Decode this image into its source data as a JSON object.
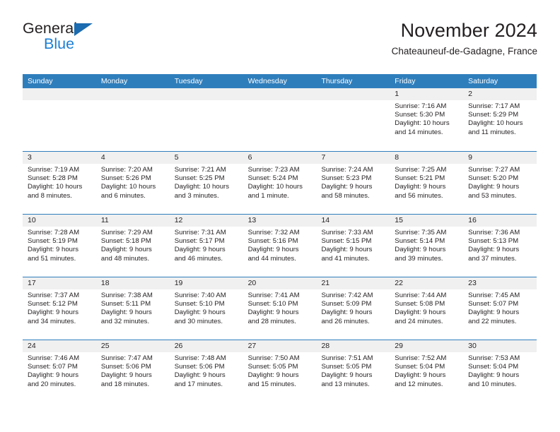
{
  "logo": {
    "word_one": "General",
    "word_two": "Blue",
    "triangle_icon": "blue-triangle-icon",
    "accent_dark": "#1b6cb0",
    "accent_light": "#1b7fd4"
  },
  "header": {
    "title": "November 2024",
    "subtitle": "Chateauneuf-de-Gadagne, France"
  },
  "theme": {
    "header_blue": "#2f7ebc",
    "day_band_gray": "#f0f0f0",
    "text": "#231f20"
  },
  "weekdays": [
    "Sunday",
    "Monday",
    "Tuesday",
    "Wednesday",
    "Thursday",
    "Friday",
    "Saturday"
  ],
  "weeks": [
    [
      {
        "day": "",
        "lines": []
      },
      {
        "day": "",
        "lines": []
      },
      {
        "day": "",
        "lines": []
      },
      {
        "day": "",
        "lines": []
      },
      {
        "day": "",
        "lines": []
      },
      {
        "day": "1",
        "lines": [
          "Sunrise: 7:16 AM",
          "Sunset: 5:30 PM",
          "Daylight: 10 hours",
          "and 14 minutes."
        ]
      },
      {
        "day": "2",
        "lines": [
          "Sunrise: 7:17 AM",
          "Sunset: 5:29 PM",
          "Daylight: 10 hours",
          "and 11 minutes."
        ]
      }
    ],
    [
      {
        "day": "3",
        "lines": [
          "Sunrise: 7:19 AM",
          "Sunset: 5:28 PM",
          "Daylight: 10 hours",
          "and 8 minutes."
        ]
      },
      {
        "day": "4",
        "lines": [
          "Sunrise: 7:20 AM",
          "Sunset: 5:26 PM",
          "Daylight: 10 hours",
          "and 6 minutes."
        ]
      },
      {
        "day": "5",
        "lines": [
          "Sunrise: 7:21 AM",
          "Sunset: 5:25 PM",
          "Daylight: 10 hours",
          "and 3 minutes."
        ]
      },
      {
        "day": "6",
        "lines": [
          "Sunrise: 7:23 AM",
          "Sunset: 5:24 PM",
          "Daylight: 10 hours",
          "and 1 minute."
        ]
      },
      {
        "day": "7",
        "lines": [
          "Sunrise: 7:24 AM",
          "Sunset: 5:23 PM",
          "Daylight: 9 hours",
          "and 58 minutes."
        ]
      },
      {
        "day": "8",
        "lines": [
          "Sunrise: 7:25 AM",
          "Sunset: 5:21 PM",
          "Daylight: 9 hours",
          "and 56 minutes."
        ]
      },
      {
        "day": "9",
        "lines": [
          "Sunrise: 7:27 AM",
          "Sunset: 5:20 PM",
          "Daylight: 9 hours",
          "and 53 minutes."
        ]
      }
    ],
    [
      {
        "day": "10",
        "lines": [
          "Sunrise: 7:28 AM",
          "Sunset: 5:19 PM",
          "Daylight: 9 hours",
          "and 51 minutes."
        ]
      },
      {
        "day": "11",
        "lines": [
          "Sunrise: 7:29 AM",
          "Sunset: 5:18 PM",
          "Daylight: 9 hours",
          "and 48 minutes."
        ]
      },
      {
        "day": "12",
        "lines": [
          "Sunrise: 7:31 AM",
          "Sunset: 5:17 PM",
          "Daylight: 9 hours",
          "and 46 minutes."
        ]
      },
      {
        "day": "13",
        "lines": [
          "Sunrise: 7:32 AM",
          "Sunset: 5:16 PM",
          "Daylight: 9 hours",
          "and 44 minutes."
        ]
      },
      {
        "day": "14",
        "lines": [
          "Sunrise: 7:33 AM",
          "Sunset: 5:15 PM",
          "Daylight: 9 hours",
          "and 41 minutes."
        ]
      },
      {
        "day": "15",
        "lines": [
          "Sunrise: 7:35 AM",
          "Sunset: 5:14 PM",
          "Daylight: 9 hours",
          "and 39 minutes."
        ]
      },
      {
        "day": "16",
        "lines": [
          "Sunrise: 7:36 AM",
          "Sunset: 5:13 PM",
          "Daylight: 9 hours",
          "and 37 minutes."
        ]
      }
    ],
    [
      {
        "day": "17",
        "lines": [
          "Sunrise: 7:37 AM",
          "Sunset: 5:12 PM",
          "Daylight: 9 hours",
          "and 34 minutes."
        ]
      },
      {
        "day": "18",
        "lines": [
          "Sunrise: 7:38 AM",
          "Sunset: 5:11 PM",
          "Daylight: 9 hours",
          "and 32 minutes."
        ]
      },
      {
        "day": "19",
        "lines": [
          "Sunrise: 7:40 AM",
          "Sunset: 5:10 PM",
          "Daylight: 9 hours",
          "and 30 minutes."
        ]
      },
      {
        "day": "20",
        "lines": [
          "Sunrise: 7:41 AM",
          "Sunset: 5:10 PM",
          "Daylight: 9 hours",
          "and 28 minutes."
        ]
      },
      {
        "day": "21",
        "lines": [
          "Sunrise: 7:42 AM",
          "Sunset: 5:09 PM",
          "Daylight: 9 hours",
          "and 26 minutes."
        ]
      },
      {
        "day": "22",
        "lines": [
          "Sunrise: 7:44 AM",
          "Sunset: 5:08 PM",
          "Daylight: 9 hours",
          "and 24 minutes."
        ]
      },
      {
        "day": "23",
        "lines": [
          "Sunrise: 7:45 AM",
          "Sunset: 5:07 PM",
          "Daylight: 9 hours",
          "and 22 minutes."
        ]
      }
    ],
    [
      {
        "day": "24",
        "lines": [
          "Sunrise: 7:46 AM",
          "Sunset: 5:07 PM",
          "Daylight: 9 hours",
          "and 20 minutes."
        ]
      },
      {
        "day": "25",
        "lines": [
          "Sunrise: 7:47 AM",
          "Sunset: 5:06 PM",
          "Daylight: 9 hours",
          "and 18 minutes."
        ]
      },
      {
        "day": "26",
        "lines": [
          "Sunrise: 7:48 AM",
          "Sunset: 5:06 PM",
          "Daylight: 9 hours",
          "and 17 minutes."
        ]
      },
      {
        "day": "27",
        "lines": [
          "Sunrise: 7:50 AM",
          "Sunset: 5:05 PM",
          "Daylight: 9 hours",
          "and 15 minutes."
        ]
      },
      {
        "day": "28",
        "lines": [
          "Sunrise: 7:51 AM",
          "Sunset: 5:05 PM",
          "Daylight: 9 hours",
          "and 13 minutes."
        ]
      },
      {
        "day": "29",
        "lines": [
          "Sunrise: 7:52 AM",
          "Sunset: 5:04 PM",
          "Daylight: 9 hours",
          "and 12 minutes."
        ]
      },
      {
        "day": "30",
        "lines": [
          "Sunrise: 7:53 AM",
          "Sunset: 5:04 PM",
          "Daylight: 9 hours",
          "and 10 minutes."
        ]
      }
    ]
  ]
}
